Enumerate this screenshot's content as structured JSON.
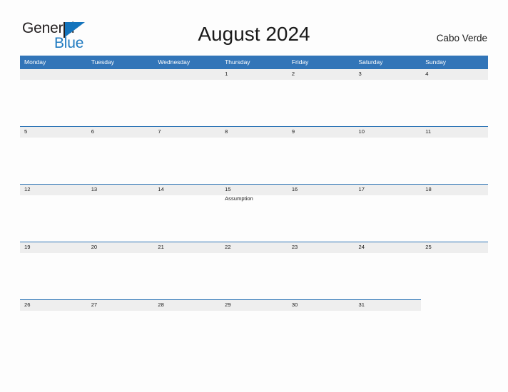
{
  "brand": {
    "name_part1": "General",
    "name_part2": "Blue",
    "flag_color": "#1474bc",
    "blue_text_color": "#1f7ac0"
  },
  "header": {
    "title": "August 2024",
    "locale": "Cabo Verde"
  },
  "theme": {
    "header_blue": "#3275b8",
    "band_gray": "#eeeeee",
    "band_line": "#2e75b6",
    "page_background": "#fdfdfd",
    "text_color": "#1a1a1a"
  },
  "calendar": {
    "weekdays": [
      "Monday",
      "Tuesday",
      "Wednesday",
      "Thursday",
      "Friday",
      "Saturday",
      "Sunday"
    ],
    "weeks": [
      {
        "band_columns": 7,
        "days": [
          {
            "date": "",
            "event": ""
          },
          {
            "date": "",
            "event": ""
          },
          {
            "date": "",
            "event": ""
          },
          {
            "date": "1",
            "event": ""
          },
          {
            "date": "2",
            "event": ""
          },
          {
            "date": "3",
            "event": ""
          },
          {
            "date": "4",
            "event": ""
          }
        ]
      },
      {
        "band_columns": 7,
        "days": [
          {
            "date": "5",
            "event": ""
          },
          {
            "date": "6",
            "event": ""
          },
          {
            "date": "7",
            "event": ""
          },
          {
            "date": "8",
            "event": ""
          },
          {
            "date": "9",
            "event": ""
          },
          {
            "date": "10",
            "event": ""
          },
          {
            "date": "11",
            "event": ""
          }
        ]
      },
      {
        "band_columns": 7,
        "days": [
          {
            "date": "12",
            "event": ""
          },
          {
            "date": "13",
            "event": ""
          },
          {
            "date": "14",
            "event": ""
          },
          {
            "date": "15",
            "event": "Assumption"
          },
          {
            "date": "16",
            "event": ""
          },
          {
            "date": "17",
            "event": ""
          },
          {
            "date": "18",
            "event": ""
          }
        ]
      },
      {
        "band_columns": 7,
        "days": [
          {
            "date": "19",
            "event": ""
          },
          {
            "date": "20",
            "event": ""
          },
          {
            "date": "21",
            "event": ""
          },
          {
            "date": "22",
            "event": ""
          },
          {
            "date": "23",
            "event": ""
          },
          {
            "date": "24",
            "event": ""
          },
          {
            "date": "25",
            "event": ""
          }
        ]
      },
      {
        "band_columns": 6,
        "days": [
          {
            "date": "26",
            "event": ""
          },
          {
            "date": "27",
            "event": ""
          },
          {
            "date": "28",
            "event": ""
          },
          {
            "date": "29",
            "event": ""
          },
          {
            "date": "30",
            "event": ""
          },
          {
            "date": "31",
            "event": ""
          },
          {
            "date": "",
            "event": ""
          }
        ]
      }
    ]
  }
}
